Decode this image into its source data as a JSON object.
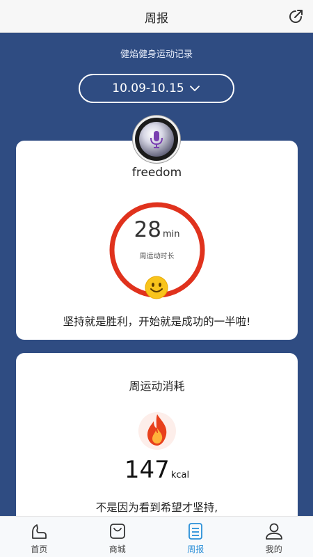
{
  "header": {
    "title": "周报"
  },
  "subtitle": "健焰健身运动记录",
  "date_range": "10.09-10.15",
  "summary": {
    "username": "freedom",
    "minutes": "28",
    "minutes_unit": "min",
    "ring_label": "周运动时长",
    "motto": "坚持就是胜利，开始就是成功的一半啦!"
  },
  "calories": {
    "heading": "周运动消耗",
    "value": "147",
    "unit": "kcal",
    "motto": "不是因为看到希望才坚持,"
  },
  "tabs": [
    {
      "label": "首页",
      "icon": "home-icon"
    },
    {
      "label": "商城",
      "icon": "shop-bag-icon"
    },
    {
      "label": "周报",
      "icon": "report-icon",
      "active": true
    },
    {
      "label": "我的",
      "icon": "profile-icon"
    }
  ],
  "colors": {
    "background": "#2f4c82",
    "ring": "#e0321d",
    "active_tab": "#2a8fd8"
  }
}
